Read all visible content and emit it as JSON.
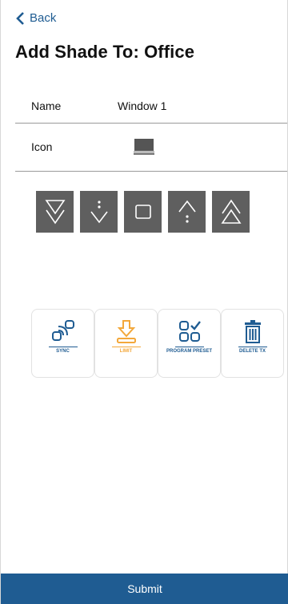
{
  "header": {
    "back_label": "Back",
    "title": "Add Shade To: Office"
  },
  "form": {
    "name_label": "Name",
    "name_value": "Window 1",
    "icon_label": "Icon"
  },
  "direction_buttons": [
    {
      "icon": "fast-down-icon"
    },
    {
      "icon": "step-down-icon"
    },
    {
      "icon": "stop-icon"
    },
    {
      "icon": "step-up-icon"
    },
    {
      "icon": "fast-up-icon"
    }
  ],
  "actions": [
    {
      "label": "SYNC",
      "icon": "sync-icon",
      "color": "#1f5c92"
    },
    {
      "label": "LIMIT",
      "icon": "limit-icon",
      "color": "#f3a83b"
    },
    {
      "label": "PROGRAM PRESET",
      "icon": "program-preset-icon",
      "color": "#1f5c92"
    },
    {
      "label": "DELETE TX",
      "icon": "delete-icon",
      "color": "#1f5c92"
    }
  ],
  "footer": {
    "submit_label": "Submit"
  },
  "colors": {
    "brand_blue": "#1f5c92",
    "accent_orange": "#f3a83b",
    "button_gray": "#5f5f5f"
  }
}
